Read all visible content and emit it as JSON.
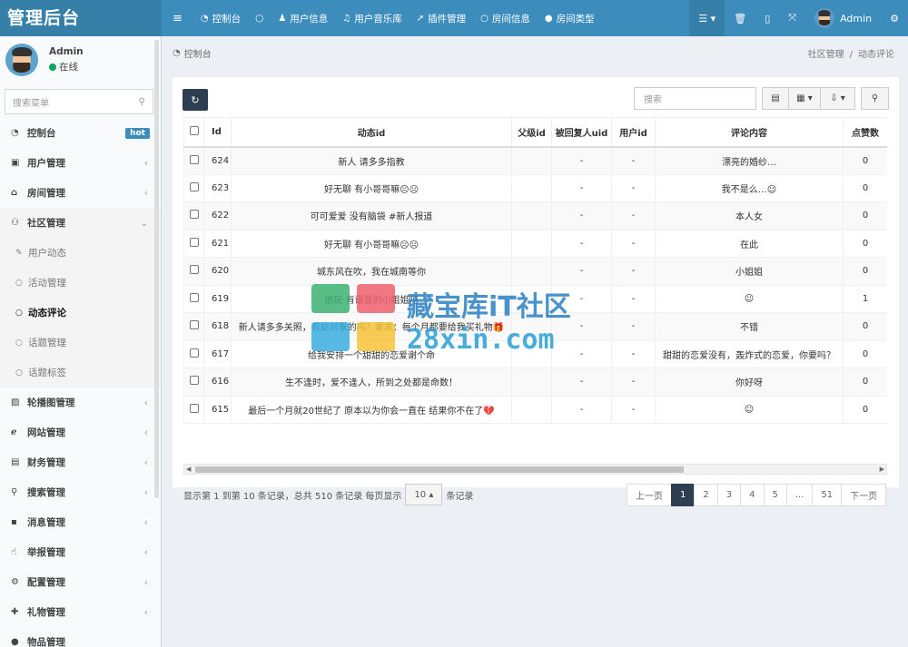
{
  "app": {
    "title": "管理后台"
  },
  "topnav": [
    {
      "icon": "menu-icon",
      "glyph": "≡",
      "label": ""
    },
    {
      "icon": "dashboard-icon",
      "glyph": "◔",
      "label": "控制台"
    },
    {
      "icon": "circle-icon",
      "glyph": "○",
      "label": ""
    },
    {
      "icon": "user-icon",
      "glyph": "♟",
      "label": "用户信息"
    },
    {
      "icon": "music-icon",
      "glyph": "♫",
      "label": "用户音乐库"
    },
    {
      "icon": "rocket-icon",
      "glyph": "➚",
      "label": "插件管理"
    },
    {
      "icon": "circle-icon",
      "glyph": "○",
      "label": "房间信息"
    },
    {
      "icon": "dot-icon",
      "glyph": "●",
      "label": "房间类型"
    }
  ],
  "topright": {
    "user": "Admin"
  },
  "sidebar": {
    "user_name": "Admin",
    "status": "在线",
    "search_placeholder": "搜索菜单",
    "items": [
      {
        "label": "控制台",
        "glyph": "◔",
        "badge": "hot"
      },
      {
        "label": "用户管理",
        "glyph": "▣",
        "chev": "‹"
      },
      {
        "label": "房间管理",
        "glyph": "⌂",
        "chev": "‹"
      },
      {
        "label": "社区管理",
        "glyph": "⚇",
        "chev": "⌄"
      }
    ],
    "sub": [
      {
        "label": "用户动态",
        "glyph": "✎"
      },
      {
        "label": "活动管理",
        "glyph": "○"
      },
      {
        "label": "动态评论",
        "glyph": "○"
      },
      {
        "label": "话题管理",
        "glyph": "○"
      },
      {
        "label": "话题标签",
        "glyph": "○"
      }
    ],
    "items2": [
      {
        "label": "轮播图管理",
        "glyph": "▨",
        "chev": "‹"
      },
      {
        "label": "网站管理",
        "glyph": "ℯ",
        "chev": "‹"
      },
      {
        "label": "财务管理",
        "glyph": "▤",
        "chev": "‹"
      },
      {
        "label": "搜索管理",
        "glyph": "⚲",
        "chev": "‹"
      },
      {
        "label": "消息管理",
        "glyph": "▪",
        "chev": "‹"
      },
      {
        "label": "举报管理",
        "glyph": "☝",
        "chev": "‹"
      },
      {
        "label": "配置管理",
        "glyph": "⚙",
        "chev": "‹"
      },
      {
        "label": "礼物管理",
        "glyph": "✚",
        "chev": "‹"
      },
      {
        "label": "物品管理",
        "glyph": "●",
        "chev": ""
      }
    ]
  },
  "breadcrumb": {
    "page": "控制台",
    "parent": "社区管理",
    "sep": "/",
    "current": "动态评论"
  },
  "toolbar": {
    "search_placeholder": "搜索"
  },
  "table": {
    "headers": [
      "Id",
      "动态id",
      "父级id",
      "被回复人uid",
      "用户id",
      "评论内容",
      "点赞数"
    ],
    "rows": [
      [
        "624",
        "新人 请多多指教",
        "",
        "-",
        "-",
        "漂亮的婚纱…",
        "0"
      ],
      [
        "623",
        "好无聊 有小哥哥嘛☹☹",
        "",
        "-",
        "-",
        "我不是么…☺",
        "0"
      ],
      [
        "622",
        "可可爱爱 没有脑袋 #新人报道",
        "",
        "-",
        "-",
        "本人女",
        "0"
      ],
      [
        "621",
        "好无聊 有小哥哥嘛☹☹",
        "",
        "-",
        "-",
        "在此",
        "0"
      ],
      [
        "620",
        "城东风在吹，我在城南等你",
        "",
        "-",
        "-",
        "小姐姐",
        "0"
      ],
      [
        "619",
        "刚玩 有语音的小姐姐吗",
        "",
        "-",
        "-",
        "☺",
        "1"
      ],
      [
        "618",
        "新人请多多关照，有处对象的吗？要求：每个月都要给我买礼物🎁",
        "",
        "-",
        "-",
        "不错",
        "0"
      ],
      [
        "617",
        "给我安排一个甜甜的恋爱谢个命",
        "",
        "-",
        "-",
        "甜甜的恋爱没有，轰炸式的恋爱，你要吗？",
        "0"
      ],
      [
        "616",
        "生不逢时，爱不逢人，所到之处都是命数！",
        "",
        "-",
        "-",
        "你好呀",
        "0"
      ],
      [
        "615",
        "最后一个月就20世纪了 原本以为你会一直在 结果你不在了💔",
        "",
        "-",
        "-",
        "☺",
        "0"
      ]
    ]
  },
  "pager": {
    "info_prefix": "显示第 1 到第 10 条记录，总共 510 条记录 每页显示",
    "page_size": "10",
    "info_suffix": "条记录",
    "prev": "上一页",
    "pages": [
      "1",
      "2",
      "3",
      "4",
      "5",
      "...",
      "51"
    ],
    "next": "下一页"
  },
  "watermark": {
    "line1": "藏宝库iT社区",
    "line2": "28xin.com"
  },
  "colors": {
    "header": "#3c8dbc",
    "logo_bg": "#367fa9",
    "primary_dark": "#2c3e50",
    "online": "#00a65a"
  }
}
